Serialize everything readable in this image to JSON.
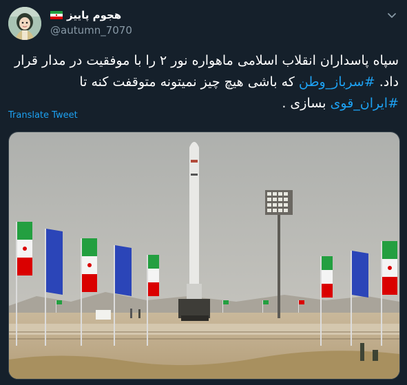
{
  "user": {
    "display_name": "هجوم پاییز",
    "handle": "@autumn_7070",
    "flag_icon": "iran-flag-icon",
    "avatar_icon": "cartoon-avatar"
  },
  "tweet": {
    "text_before": "سپاه پاسداران انقلاب اسلامی ماهواره نور ۲ را با موفقیت در مدار قرار داد.",
    "hashtag1": "#سرباز_وطن",
    "text_middle": " که باشی هیچ چیز نمیتونه متوقفت کنه تا ",
    "hashtag2": "#ایران_قوی",
    "text_after": " بسازی ."
  },
  "translate_label": "Translate Tweet",
  "colors": {
    "background": "#15202b",
    "link": "#1da1f2",
    "secondary_text": "#8899a6"
  }
}
